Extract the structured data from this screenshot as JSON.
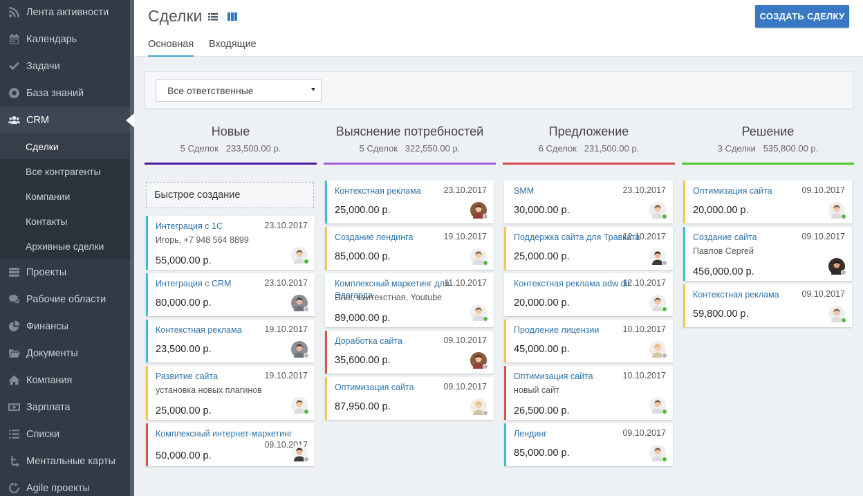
{
  "colors": {
    "sidebar_bg": "#323a45",
    "primary_button": "#3978c2",
    "link": "#2f73a8",
    "online": "#52b83b",
    "offline": "#b0b5bb"
  },
  "sidebar": {
    "items": [
      {
        "label": "Лента активности",
        "icon": "rss-icon"
      },
      {
        "label": "Календарь",
        "icon": "calendar-icon"
      },
      {
        "label": "Задачи",
        "icon": "check-icon"
      },
      {
        "label": "База знаний",
        "icon": "lifebuoy-icon"
      },
      {
        "label": "CRM",
        "icon": "users-icon"
      },
      {
        "label": "Проекты",
        "icon": "projects-icon"
      },
      {
        "label": "Рабочие области",
        "icon": "chat-icon"
      },
      {
        "label": "Финансы",
        "icon": "pie-chart-icon"
      },
      {
        "label": "Документы",
        "icon": "folder-icon"
      },
      {
        "label": "Компания",
        "icon": "home-icon"
      },
      {
        "label": "Зарплата",
        "icon": "money-icon"
      },
      {
        "label": "Списки",
        "icon": "list-icon"
      },
      {
        "label": "Ментальные карты",
        "icon": "mindmap-icon"
      },
      {
        "label": "Agile проекты",
        "icon": "agile-icon"
      }
    ],
    "crm_sub": [
      "Сделки",
      "Все контрагенты",
      "Компании",
      "Контакты",
      "Архивные сделки"
    ]
  },
  "header": {
    "title": "Сделки",
    "create_button": "СОЗДАТЬ СДЕЛКУ",
    "tabs": [
      "Основная",
      "Входящие"
    ]
  },
  "filter": {
    "responsible": "Все ответственные"
  },
  "board": {
    "quick_create": "Быстрое создание",
    "columns": [
      {
        "title": "Новые",
        "count": "5 Сделок",
        "sum": "233,500.00 р.",
        "color": "#4a1aa0",
        "cards": [
          {
            "title": "Интеграция с 1С",
            "date": "23.10.2017",
            "sub": "Игорь, +7 948 564 8899",
            "amount": "55,000.00 р.",
            "color": "#3fbecf",
            "avatar": "avatar-man-light",
            "online": true
          },
          {
            "title": "Интеграция с CRM",
            "date": "23.10.2017",
            "sub": "",
            "amount": "80,000.00 р.",
            "color": "#3fbecf",
            "avatar": "avatar-man-grey",
            "online": false
          },
          {
            "title": "Контекстная реклама",
            "date": "19.10.2017",
            "sub": "",
            "amount": "23,500.00 р.",
            "color": "#3fbecf",
            "avatar": "avatar-man-grey",
            "online": false
          },
          {
            "title": "Развитие сайта",
            "date": "19.10.2017",
            "sub": "установка новых плагинов",
            "amount": "25,000.00 р.",
            "color": "#f0c94a",
            "avatar": "avatar-man-light",
            "online": true
          },
          {
            "title": "Комплексный интернет-маркетинг",
            "date": "09.10.2017",
            "sub": "",
            "amount": "50,000.00 р.",
            "color": "#d9534f",
            "avatar": "avatar-woman-dark",
            "online": false
          }
        ]
      },
      {
        "title": "Выяснение потребностей",
        "count": "5 Сделок",
        "sum": "322,550.00 р.",
        "color": "#a25fe0",
        "cards": [
          {
            "title": "Контекстная реклама",
            "date": "23.10.2017",
            "sub": "",
            "amount": "25,000.00 р.",
            "color": "#3fbecf",
            "avatar": "avatar-woman-red",
            "online": false
          },
          {
            "title": "Создание лендинга",
            "date": "19.10.2017",
            "sub": "",
            "amount": "85,000.00 р.",
            "color": "#f0c94a",
            "avatar": "avatar-man-light",
            "online": true
          },
          {
            "title": "Комплексный маркетинг для Эдогарда",
            "date": "11.10.2017",
            "sub": "Блог, контекстная, Youtube",
            "amount": "89,000.00 р.",
            "color": "#ffffff",
            "avatar": "avatar-man-light",
            "online": true
          },
          {
            "title": "Доработка сайта",
            "date": "09.10.2017",
            "sub": "",
            "amount": "35,600.00 р.",
            "color": "#d9534f",
            "avatar": "avatar-woman-red",
            "online": false
          },
          {
            "title": "Оптимизация сайта",
            "date": "09.10.2017",
            "sub": "",
            "amount": "87,950.00 р.",
            "color": "#f0c94a",
            "avatar": "avatar-woman-blonde",
            "online": false
          }
        ]
      },
      {
        "title": "Предложение",
        "count": "6 Сделок",
        "sum": "231,500.00 р.",
        "color": "#d9474f",
        "cards": [
          {
            "title": "SMM",
            "date": "23.10.2017",
            "sub": "",
            "amount": "30,000.00 р.",
            "color": "#ffffff",
            "avatar": "avatar-man-light",
            "online": true
          },
          {
            "title": "Поддержка сайта для Травката",
            "date": "12.10.2017",
            "sub": "",
            "amount": "25,000.00 р.",
            "color": "#f0c94a",
            "avatar": "avatar-woman-dark",
            "online": false
          },
          {
            "title": "Контекстная реклама adw dir",
            "date": "12.10.2017",
            "sub": "",
            "amount": "20,000.00 р.",
            "color": "#ffffff",
            "avatar": "avatar-man-light",
            "online": true
          },
          {
            "title": "Продление лицензии",
            "date": "10.10.2017",
            "sub": "",
            "amount": "45,000.00 р.",
            "color": "#f0c94a",
            "avatar": "avatar-woman-blonde",
            "online": false
          },
          {
            "title": "Оптимизация сайта",
            "date": "10.10.2017",
            "sub": "новый сайт",
            "amount": "26,500.00 р.",
            "color": "#d9534f",
            "avatar": "avatar-man-light",
            "online": true
          },
          {
            "title": "Лендинг",
            "date": "09.10.2017",
            "sub": "",
            "amount": "85,000.00 р.",
            "color": "#3fbecf",
            "avatar": "avatar-man-light",
            "online": true
          }
        ]
      },
      {
        "title": "Решение",
        "count": "3 Сделки",
        "sum": "535,800.00 р.",
        "color": "#4fc52e",
        "cards": [
          {
            "title": "Оптимизация сайта",
            "date": "09.10.2017",
            "sub": "",
            "amount": "20,000.00 р.",
            "color": "#f0c94a",
            "avatar": "avatar-man-light",
            "online": true
          },
          {
            "title": "Создание сайта",
            "date": "09.10.2017",
            "sub": "Павлов Сергей",
            "amount": "456,000.00 р.",
            "color": "#3fbecf",
            "avatar": "avatar-man-dark",
            "online": false
          },
          {
            "title": "Контекстная реклама",
            "date": "09.10.2017",
            "sub": "",
            "amount": "59,800.00 р.",
            "color": "#f0c94a",
            "avatar": "avatar-man-light",
            "online": true
          }
        ]
      }
    ]
  }
}
